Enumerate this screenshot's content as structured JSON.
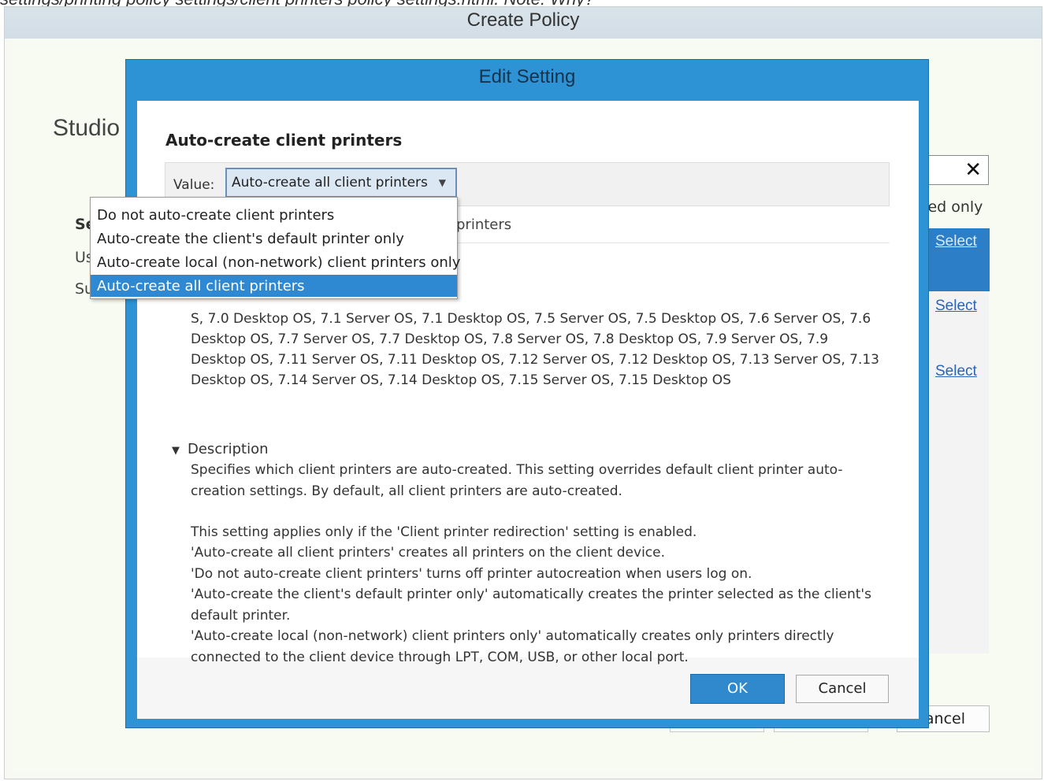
{
  "top_caption": "settings/printing policy settings/client printers policy settings.html. Note: Why?",
  "outer_window": {
    "title": "Create Policy",
    "studio_heading": "Studio",
    "left_labels": [
      "Se",
      "Us",
      "Su"
    ],
    "selected_only": "ted only",
    "close_icon": "✕",
    "select_links": [
      "Select",
      "Select",
      "Select"
    ],
    "cancel_label": "ancel"
  },
  "dialog": {
    "title": "Edit Setting",
    "setting_title": "Auto-create client printers",
    "value_label": "Value:",
    "selected_value": "Auto-create all client printers",
    "ghost_printers": "printers",
    "applies_to": "S, 7.0 Desktop OS, 7.1 Server OS, 7.1 Desktop OS, 7.5 Server OS, 7.5 Desktop OS, 7.6 Server OS, 7.6 Desktop OS, 7.7 Server OS, 7.7 Desktop OS, 7.8 Server OS, 7.8 Desktop OS, 7.9 Server OS, 7.9 Desktop OS, 7.11 Server OS, 7.11 Desktop OS, 7.12 Server OS, 7.12 Desktop OS, 7.13 Server OS, 7.13 Desktop OS, 7.14 Server OS, 7.14 Desktop OS, 7.15 Server OS, 7.15 Desktop OS",
    "description_header": "Description",
    "description": [
      "Specifies which client printers are auto-created. This setting overrides default client printer auto-creation settings. By default, all client printers are auto-created.",
      "This setting applies only if the 'Client printer redirection' setting is enabled.",
      "'Auto-create all client printers' creates all printers on the client device.",
      "'Do not auto-create client printers' turns off printer autocreation when users log on.",
      "'Auto-create the client's default printer only' automatically creates the printer selected as the client's default printer.",
      "'Auto-create local (non-network) client printers only' automatically creates only printers directly connected to the client device through LPT, COM, USB, or other local port."
    ],
    "ok_label": "OK",
    "cancel_label": "Cancel"
  },
  "dropdown": {
    "options": [
      "Do not auto-create client printers",
      "Auto-create the client's default printer only",
      "Auto-create local (non-network) client printers only",
      "Auto-create all client printers"
    ],
    "selected_index": 3
  },
  "colors": {
    "dialog_frame": "#2d93d5",
    "selection": "#2f89d2",
    "ok_button": "#2f89cc"
  }
}
